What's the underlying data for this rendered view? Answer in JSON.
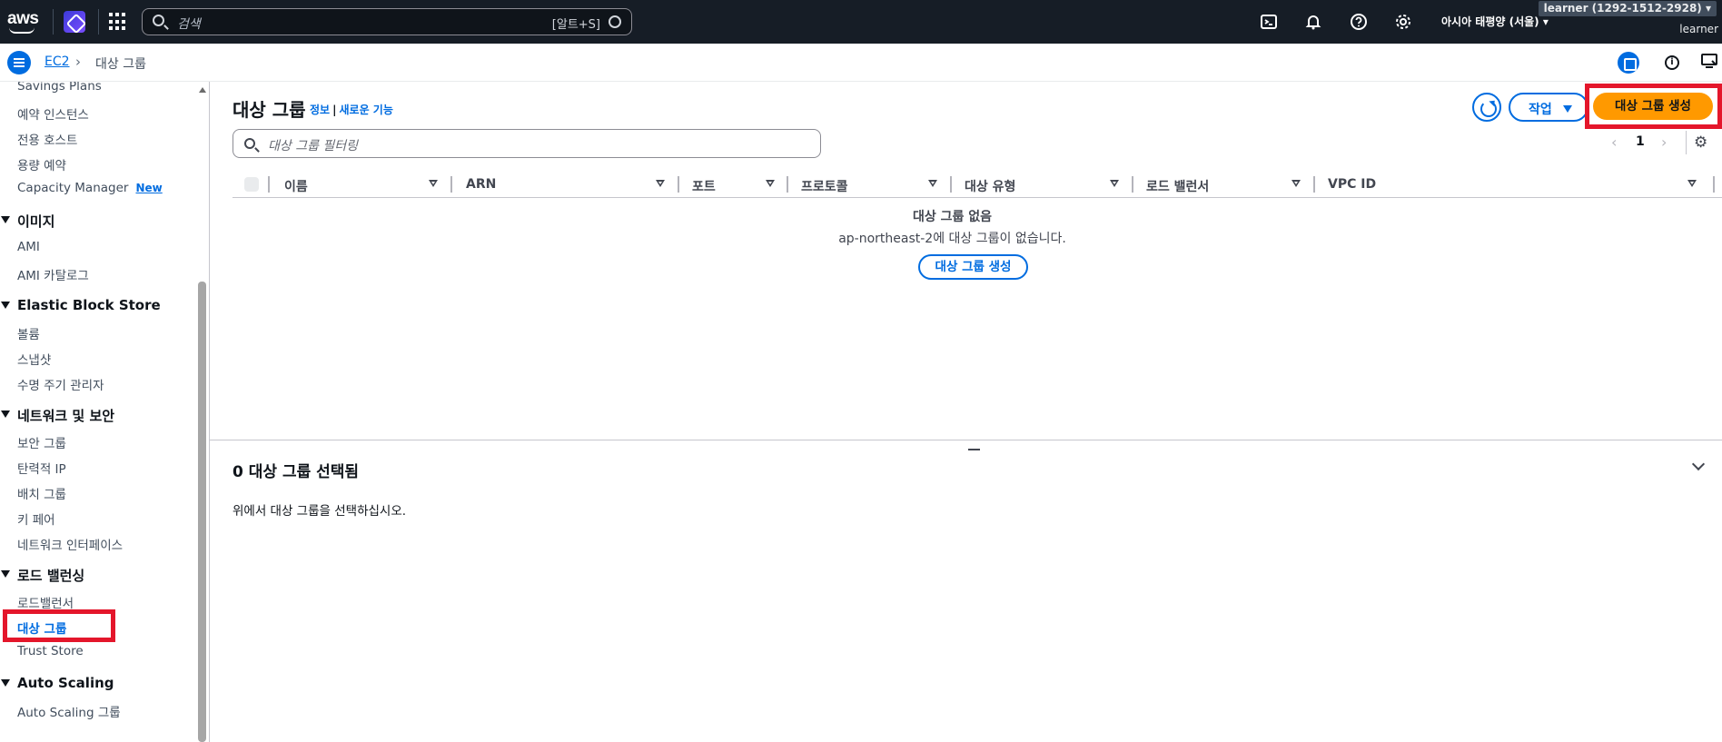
{
  "topnav": {
    "logo_text": "aws",
    "search_placeholder": "검색",
    "search_shortcut": "[알트+S]",
    "region": "아시아 태평양 (서울)",
    "account": "learner (1292-1512-2928)",
    "user": "learner"
  },
  "breadcrumb": {
    "root": "EC2",
    "current": "대상 그룹"
  },
  "sidebar": {
    "items_top": [
      "Savings Plans",
      "예약 인스턴스",
      "전용 호스트",
      "용량 예약"
    ],
    "capacity_manager": "Capacity Manager",
    "new_badge": "New",
    "images_header": "이미지",
    "images_items": [
      "AMI",
      "AMI 카탈로그"
    ],
    "ebs_header": "Elastic Block Store",
    "ebs_items": [
      "볼륨",
      "스냅샷",
      "수명 주기 관리자"
    ],
    "network_header": "네트워크 및 보안",
    "network_items": [
      "보안 그룹",
      "탄력적 IP",
      "배치 그룹",
      "키 페어",
      "네트워크 인터페이스"
    ],
    "lb_header": "로드 밸런싱",
    "lb_items": [
      "로드밸런서",
      "대상 그룹",
      "Trust Store"
    ],
    "as_header": "Auto Scaling",
    "as_items": [
      "Auto Scaling 그룹"
    ]
  },
  "main": {
    "title": "대상 그룹",
    "info_link": "정보",
    "separator": "|",
    "new_features_link": "새로운 기능",
    "actions_label": "작업",
    "create_label": "대상 그룹 생성",
    "filter_placeholder": "대상 그룹 필터링",
    "page_number": "1",
    "columns": [
      "이름",
      "ARN",
      "포트",
      "프로토콜",
      "대상 유형",
      "로드 밸런서",
      "VPC ID"
    ],
    "empty_title": "대상 그룹 없음",
    "empty_desc": "ap-northeast-2에 대상 그룹이 없습니다.",
    "empty_create_label": "대상 그룹 생성"
  },
  "detail": {
    "title": "0 대상 그룹 선택됨",
    "desc": "위에서 대상 그룹을 선택하십시오."
  },
  "colors": {
    "topnav_bg": "#161d26",
    "link_blue": "#006ce0",
    "primary_orange": "#ff9900",
    "highlight_red": "#e4162b"
  }
}
